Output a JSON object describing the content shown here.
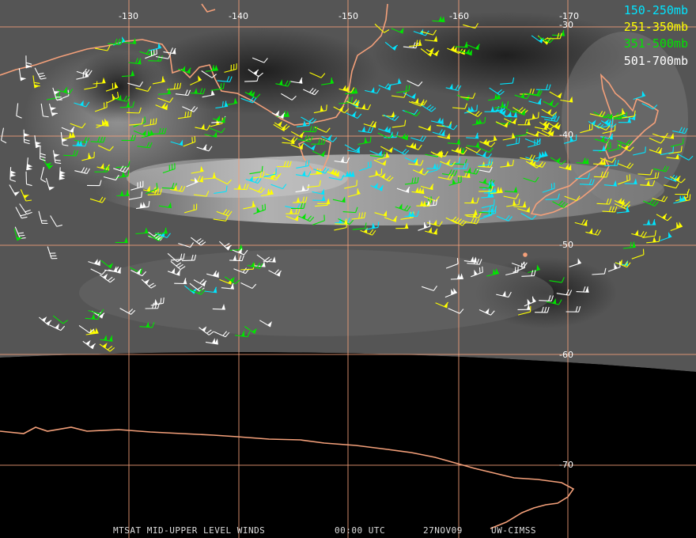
{
  "legend": [
    {
      "label": "150-250mb",
      "color": "#00e5ff"
    },
    {
      "label": "251-350mb",
      "color": "#ffff00"
    },
    {
      "label": "351-500mb",
      "color": "#00e600"
    },
    {
      "label": "501-700mb",
      "color": "#ffffff"
    }
  ],
  "longitude_labels": [
    "-130",
    "-140",
    "-150",
    "-160",
    "-170"
  ],
  "latitude_labels": [
    "-30",
    "-40",
    "-50",
    "-60",
    "-70"
  ],
  "footer": {
    "product": "MTSAT MID-UPPER LEVEL WINDS",
    "time": "00:00 UTC",
    "date": "27NOV09",
    "source": "UW-CIMSS"
  },
  "colors": {
    "grid": "#f4a07a",
    "coast": "#f4a07a",
    "space": "#000000"
  }
}
